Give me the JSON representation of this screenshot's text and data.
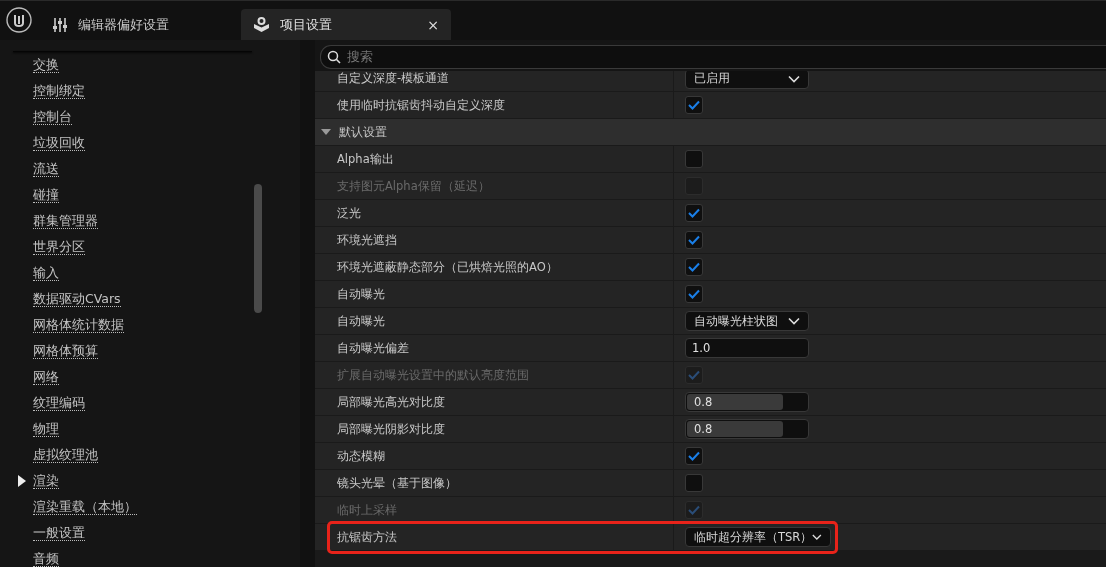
{
  "tabs": [
    {
      "label": "编辑器偏好设置",
      "kind": "prefs",
      "selected": false
    },
    {
      "label": "项目设置",
      "kind": "project",
      "selected": true,
      "close": "×"
    }
  ],
  "sidebar": {
    "items": [
      {
        "label": "交换",
        "selected": false
      },
      {
        "label": "控制绑定",
        "selected": false
      },
      {
        "label": "控制台",
        "selected": false
      },
      {
        "label": "垃圾回收",
        "selected": false
      },
      {
        "label": "流送",
        "selected": false
      },
      {
        "label": "碰撞",
        "selected": false
      },
      {
        "label": "群集管理器",
        "selected": false
      },
      {
        "label": "世界分区",
        "selected": false
      },
      {
        "label": "输入",
        "selected": false
      },
      {
        "label": "数据驱动CVars",
        "selected": false
      },
      {
        "label": "网格体统计数据",
        "selected": false
      },
      {
        "label": "网格体预算",
        "selected": false
      },
      {
        "label": "网络",
        "selected": false
      },
      {
        "label": "纹理编码",
        "selected": false
      },
      {
        "label": "物理",
        "selected": false
      },
      {
        "label": "虚拟纹理池",
        "selected": false
      },
      {
        "label": "渲染",
        "selected": true
      },
      {
        "label": "渲染重载（本地）",
        "selected": false
      },
      {
        "label": "一般设置",
        "selected": false
      },
      {
        "label": "音频",
        "selected": false
      }
    ]
  },
  "search": {
    "placeholder": "搜索"
  },
  "settings": [
    {
      "kind": "dropdown",
      "label": "自定义深度-模板通道",
      "value": "已启用",
      "disabled": false,
      "partial": true
    },
    {
      "kind": "checkbox",
      "label": "使用临时抗锯齿抖动自定义深度",
      "checked": true,
      "disabled": false
    },
    {
      "kind": "header",
      "label": "默认设置",
      "expanded": true
    },
    {
      "kind": "checkbox",
      "label": "Alpha输出",
      "checked": false,
      "disabled": false
    },
    {
      "kind": "checkbox",
      "label": "支持图元Alpha保留（延迟）",
      "checked": false,
      "disabled": true
    },
    {
      "kind": "checkbox",
      "label": "泛光",
      "checked": true,
      "disabled": false
    },
    {
      "kind": "checkbox",
      "label": "环境光遮挡",
      "checked": true,
      "disabled": false
    },
    {
      "kind": "checkbox",
      "label": "环境光遮蔽静态部分（已烘焙光照的AO）",
      "checked": true,
      "disabled": false
    },
    {
      "kind": "checkbox",
      "label": "自动曝光",
      "checked": true,
      "disabled": false
    },
    {
      "kind": "dropdown",
      "label": "自动曝光",
      "value": "自动曝光柱状图",
      "disabled": false
    },
    {
      "kind": "number",
      "label": "自动曝光偏差",
      "value": "1.0",
      "disabled": false
    },
    {
      "kind": "checkbox",
      "label": "扩展自动曝光设置中的默认亮度范围",
      "checked": true,
      "disabled": true
    },
    {
      "kind": "slider",
      "label": "局部曝光高光对比度",
      "value": "0.8",
      "level": 0.8,
      "disabled": false
    },
    {
      "kind": "slider",
      "label": "局部曝光阴影对比度",
      "value": "0.8",
      "level": 0.8,
      "disabled": false
    },
    {
      "kind": "checkbox",
      "label": "动态模糊",
      "checked": true,
      "disabled": false
    },
    {
      "kind": "checkbox",
      "label": "镜头光晕（基于图像）",
      "checked": false,
      "disabled": false
    },
    {
      "kind": "checkbox",
      "label": "临时上采样",
      "checked": true,
      "disabled": true
    },
    {
      "kind": "dropdown",
      "label": "抗锯齿方法",
      "value": "临时超分辨率（TSR）",
      "disabled": false,
      "highlighted": true
    }
  ]
}
